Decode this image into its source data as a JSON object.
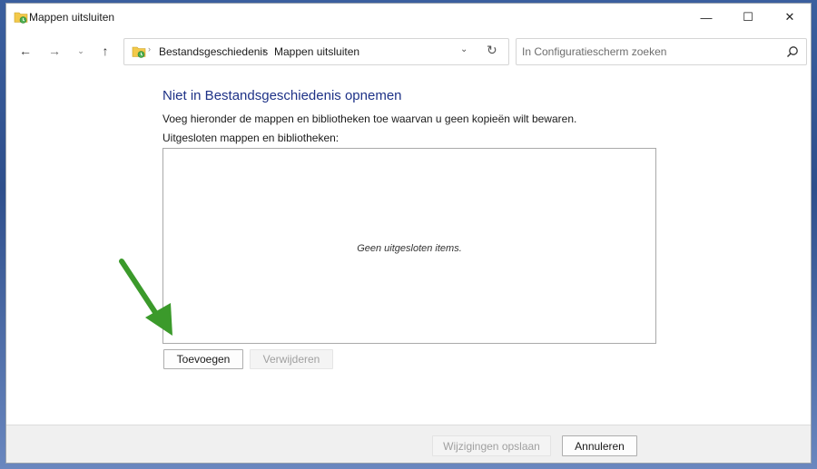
{
  "window": {
    "title": "Mappen uitsluiten",
    "title_icon": "folder-history-icon"
  },
  "window_controls": {
    "minimize": "—",
    "maximize": "☐",
    "close": "✕"
  },
  "navigation": {
    "back": "←",
    "forward": "→",
    "recent_dropdown": "⌄",
    "up": "↑"
  },
  "address_bar": {
    "icon": "folder-history-icon",
    "breadcrumbs": [
      "Bestandsgeschiedenis",
      "Mappen uitsluiten"
    ],
    "separator": "›",
    "dropdown": "⌄",
    "refresh": "↻"
  },
  "search": {
    "placeholder": "In Configuratiescherm zoeken"
  },
  "main": {
    "heading": "Niet in Bestandsgeschiedenis opnemen",
    "description": "Voeg hieronder de mappen en bibliotheken toe waarvan u geen kopieën wilt bewaren.",
    "list_label": "Uitgesloten mappen en bibliotheken:",
    "empty_message": "Geen uitgesloten items.",
    "add_button": "Toevoegen",
    "remove_button": "Verwijderen"
  },
  "footer": {
    "save_button": "Wijzigingen opslaan",
    "cancel_button": "Annuleren"
  },
  "colors": {
    "heading": "#1e3287",
    "annotation_arrow": "#3b9a2b"
  }
}
